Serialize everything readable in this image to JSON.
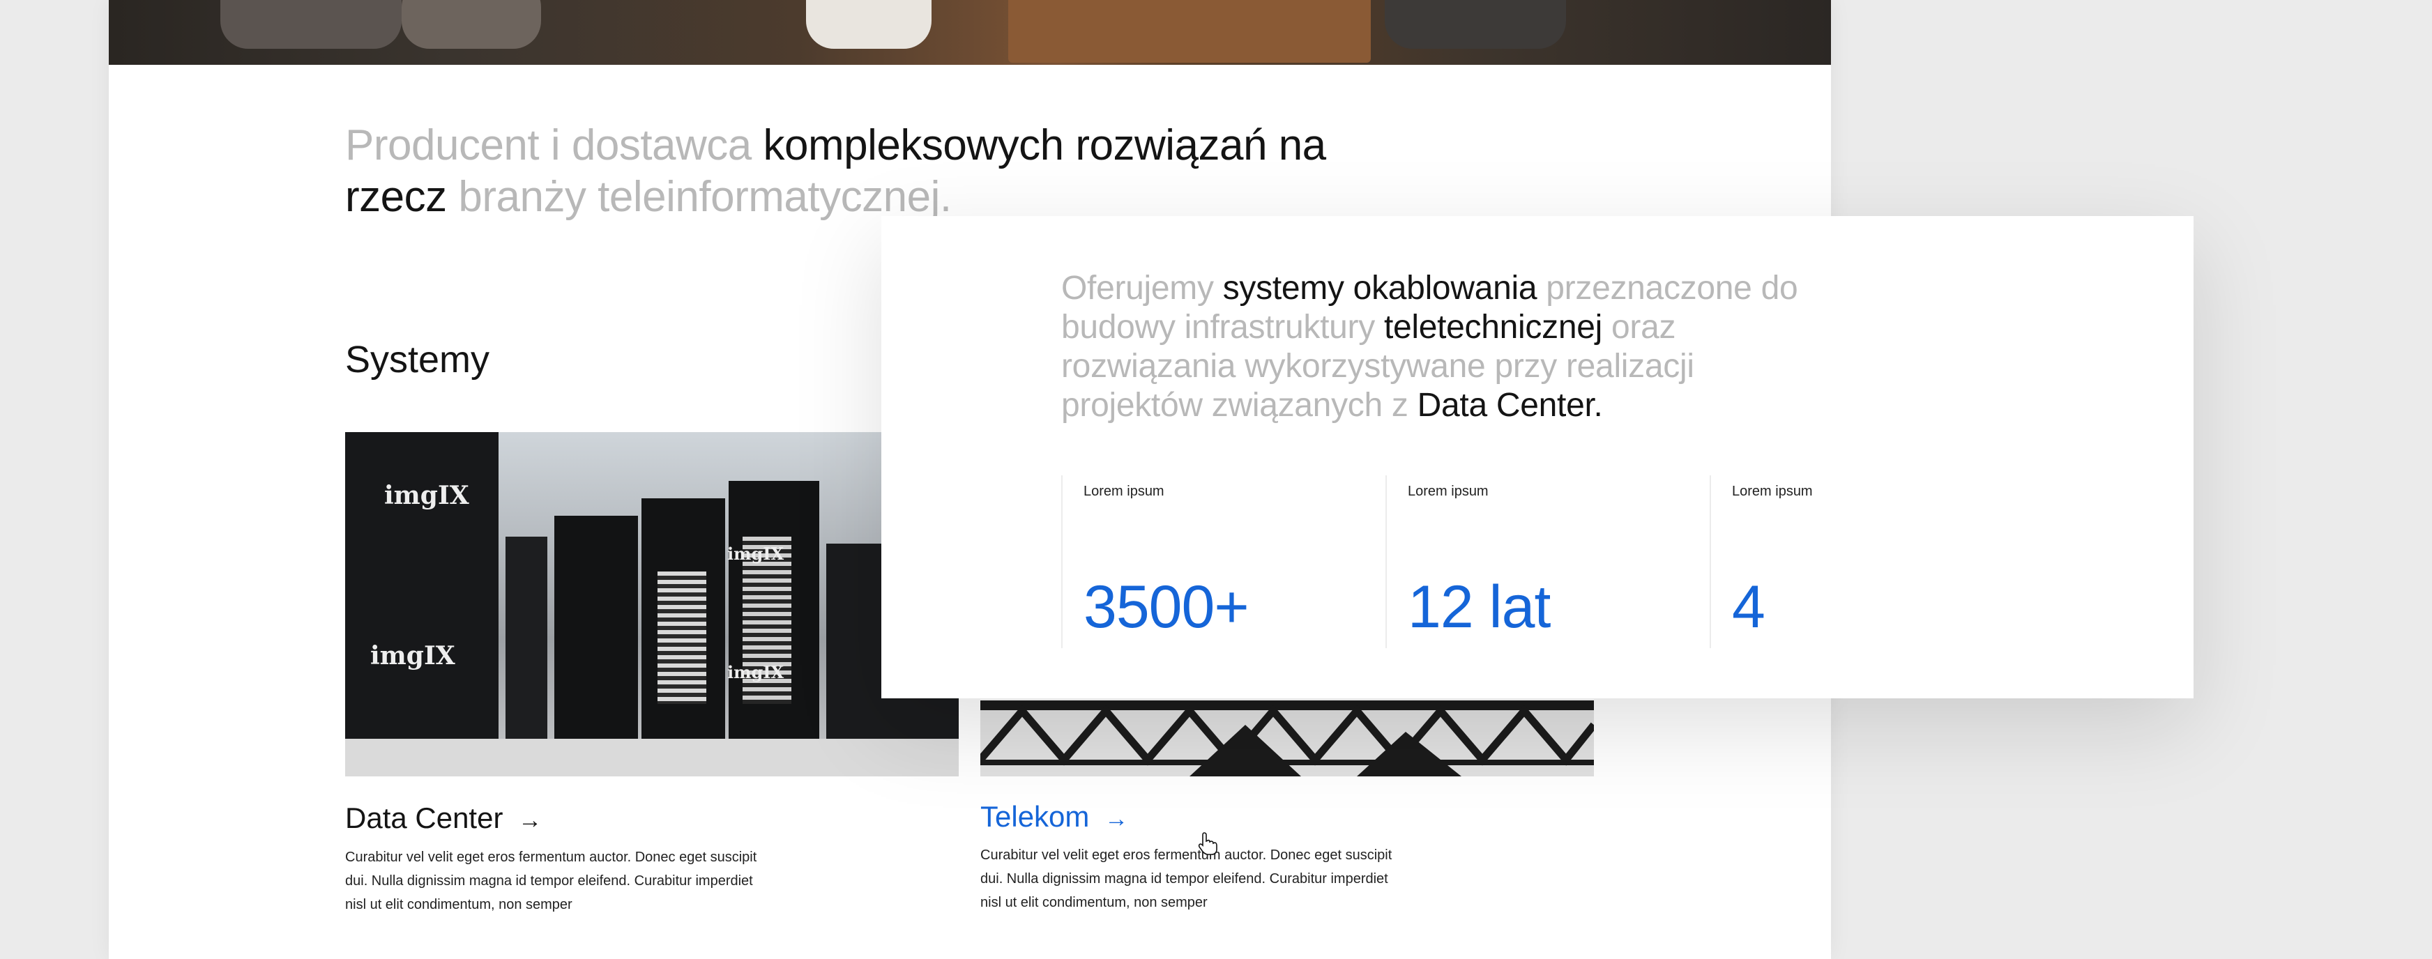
{
  "hero": {
    "image": "meeting-photo"
  },
  "intro": {
    "part1_muted": "Producent i dostawca ",
    "part2_strong": "kompleksowych rozwiązań na rzecz",
    "part3_muted": " branży teleinformatycznej."
  },
  "systems": {
    "title": "Systemy",
    "cards": [
      {
        "title": "Data Center",
        "arrow": "→",
        "description": "Curabitur vel velit eget eros fermentum auctor. Donec eget suscipit dui. Nulla dignissim magna id tempor eleifend. Curabitur imperdiet nisl ut elit condimentum, non semper",
        "image_brand": "imgIX",
        "title_color": "#141414"
      },
      {
        "title": "Telekom",
        "arrow": "→",
        "description": "Curabitur vel velit eget eros fermentum auctor. Donec eget suscipit dui. Nulla dignissim magna id tempor eleifend. Curabitur imperdiet nisl ut elit condimentum, non semper",
        "title_color": "#1565d8"
      }
    ]
  },
  "offer": {
    "t1_muted": "Oferujemy ",
    "t2_strong": "systemy okablowania",
    "t3_muted": " przeznaczone do budowy infrastruktury ",
    "t4_strong": "teletechnicznej",
    "t5_muted": " oraz rozwiązania wykorzystywane przy realizacji projektów związanych z ",
    "t6_strong": "Data Center.",
    "stats": [
      {
        "label": "Lorem ipsum",
        "value": "3500+"
      },
      {
        "label": "Lorem ipsum",
        "value": "12 lat"
      },
      {
        "label": "Lorem ipsum",
        "value": "4"
      }
    ]
  },
  "colors": {
    "accent": "#1565d8",
    "muted_text": "#b8b8b8",
    "background": "#ebebeb"
  }
}
